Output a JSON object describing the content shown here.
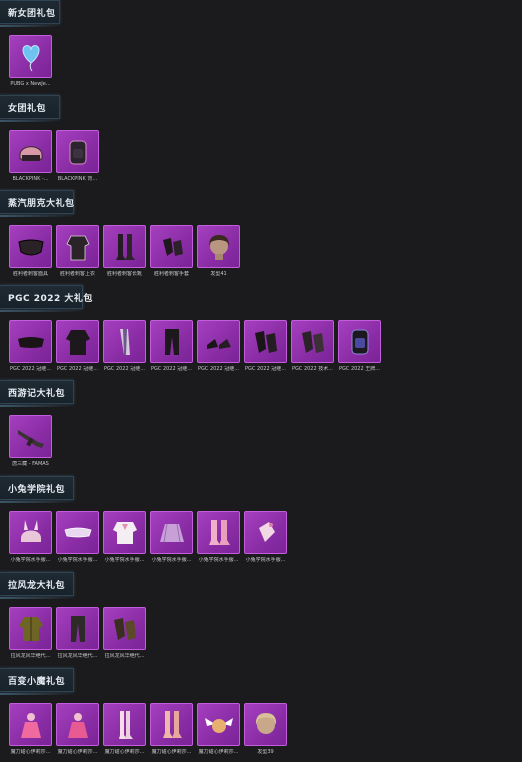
{
  "sections": [
    {
      "title": "新女团礼包",
      "items": [
        {
          "label": "PUBG x NewJe...",
          "icon": "heart-balloon-icon"
        }
      ]
    },
    {
      "title": "女团礼包",
      "items": [
        {
          "label": "BLACKPINK -...",
          "icon": "helmet-icon"
        },
        {
          "label": "BLACKPINK 背...",
          "icon": "backpack-icon"
        }
      ]
    },
    {
      "title": "蒸汽朋克大礼包",
      "items": [
        {
          "label": "胜利者刺客面具",
          "icon": "mask-icon"
        },
        {
          "label": "胜利者刺客上衣",
          "icon": "jacket-icon"
        },
        {
          "label": "胜利者刺客长靴",
          "icon": "boots-icon"
        },
        {
          "label": "胜利者刺客手套",
          "icon": "gloves-icon"
        },
        {
          "label": "发型41",
          "icon": "hairstyle-icon"
        }
      ]
    },
    {
      "title": "PGC 2022 大礼包",
      "items": [
        {
          "label": "PGC 2022 冠继...",
          "icon": "goggles-icon"
        },
        {
          "label": "PGC 2022 冠继...",
          "icon": "jacket-icon"
        },
        {
          "label": "PGC 2022 冠继...",
          "icon": "scarf-icon"
        },
        {
          "label": "PGC 2022 冠继...",
          "icon": "pants-icon"
        },
        {
          "label": "PGC 2022 冠继...",
          "icon": "shoes-icon"
        },
        {
          "label": "PGC 2022 冠继...",
          "icon": "gloves-icon"
        },
        {
          "label": "PGC 2022 技术...",
          "icon": "gloves-icon"
        },
        {
          "label": "PGC 2022 王牌...",
          "icon": "backpack-icon"
        }
      ]
    },
    {
      "title": "西游记大礼包",
      "items": [
        {
          "label": "唐三藏 - FAMAS",
          "icon": "rifle-icon"
        }
      ]
    },
    {
      "title": "小兔学院礼包",
      "items": [
        {
          "label": "小兔学院水手服...",
          "icon": "bunny-helmet-icon"
        },
        {
          "label": "小兔学院水手服...",
          "icon": "visor-icon"
        },
        {
          "label": "小兔学院水手服...",
          "icon": "sailor-top-icon"
        },
        {
          "label": "小兔学院水手服...",
          "icon": "skirt-icon"
        },
        {
          "label": "小兔学院水手服...",
          "icon": "boots-icon"
        },
        {
          "label": "小兔学院水手服...",
          "icon": "glove-icon"
        }
      ]
    },
    {
      "title": "拉风龙大礼包",
      "items": [
        {
          "label": "拉风龙风华绝代...",
          "icon": "jacket-icon"
        },
        {
          "label": "拉风龙风华绝代...",
          "icon": "pants-icon"
        },
        {
          "label": "拉风龙风华绝代...",
          "icon": "gloves-icon"
        }
      ]
    },
    {
      "title": "百变小魔礼包",
      "items": [
        {
          "label": "魔力甜心伊莉莎...",
          "icon": "outfit-icon"
        },
        {
          "label": "魔力甜心伊莉莎...",
          "icon": "outfit-icon"
        },
        {
          "label": "魔力甜心伊莉莎...",
          "icon": "stockings-icon"
        },
        {
          "label": "魔力甜心伊莉莎...",
          "icon": "boots-icon"
        },
        {
          "label": "魔力甜心伊莉莎...",
          "icon": "winged-orb-icon"
        },
        {
          "label": "发型39",
          "icon": "hairstyle-icon"
        }
      ]
    }
  ]
}
